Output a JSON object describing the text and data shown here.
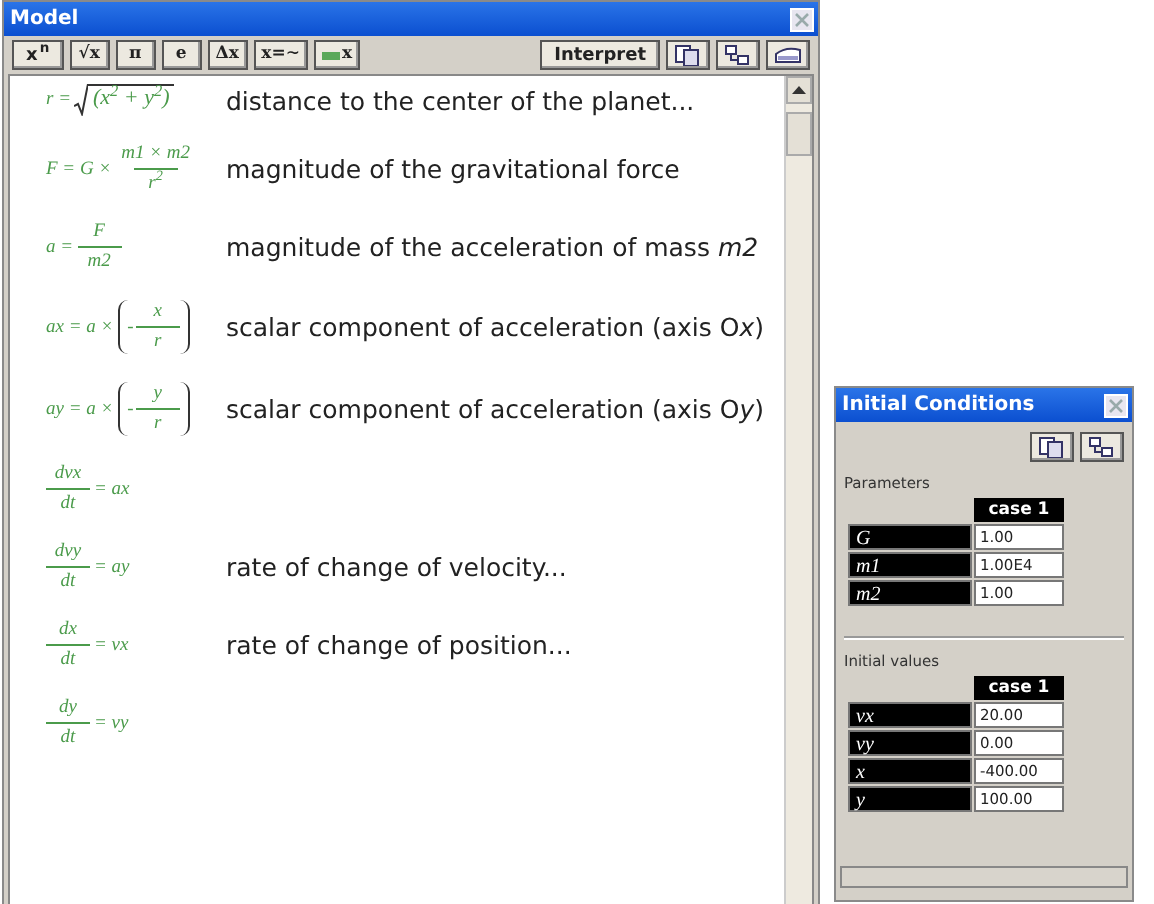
{
  "model": {
    "title": "Model",
    "toolbar": {
      "left": [
        {
          "kind": "text",
          "label": "x$^{n}$"
        },
        {
          "kind": "text",
          "label": "√x"
        },
        {
          "kind": "text",
          "label": "π"
        },
        {
          "kind": "text",
          "label": "e"
        },
        {
          "kind": "text",
          "label": "Δx"
        },
        {
          "kind": "text",
          "label": "x=∼"
        },
        {
          "kind": "prefixed",
          "label": "x"
        }
      ],
      "right": [
        {
          "kind": "text",
          "label": "Interpret"
        },
        {
          "kind": "copy"
        },
        {
          "kind": "connect"
        },
        {
          "kind": "device"
        }
      ]
    },
    "rows": [
      {
        "formula": [
          {
            "kind": "text",
            "s": "r ="
          },
          {
            "kind": "sqrt",
            "s": "(x$^{2}$ + y$^{2}$)"
          }
        ],
        "description": [
          {
            "s": "distance to the center of the planet..."
          }
        ]
      },
      {
        "formula": [
          {
            "kind": "text",
            "s": "F = G ×"
          },
          {
            "kind": "frac",
            "num": "m1 × m2",
            "den": "r$^{2}$"
          }
        ],
        "description": [
          {
            "s": "magnitude of the gravitational force"
          }
        ]
      },
      {
        "formula": [
          {
            "kind": "text",
            "s": "a ="
          },
          {
            "kind": "frac",
            "num": "F",
            "den": "m2"
          }
        ],
        "description": [
          {
            "s": "magnitude of the acceleration of mass "
          },
          {
            "s": "m2",
            "italic": true
          }
        ]
      },
      {
        "formula": [
          {
            "kind": "text",
            "s": "ax = a ×"
          },
          {
            "kind": "paren",
            "items": [
              {
                "kind": "text",
                "s": "-"
              },
              {
                "kind": "frac",
                "num": "x",
                "den": "r"
              }
            ]
          }
        ],
        "description": [
          {
            "s": "scalar component of acceleration (axis O"
          },
          {
            "s": "x",
            "italic": true
          },
          {
            "s": ")"
          }
        ]
      },
      {
        "formula": [
          {
            "kind": "text",
            "s": "ay = a ×"
          },
          {
            "kind": "paren",
            "items": [
              {
                "kind": "text",
                "s": "-"
              },
              {
                "kind": "frac",
                "num": "y",
                "den": "r"
              }
            ]
          }
        ],
        "description": [
          {
            "s": "scalar component of acceleration (axis O"
          },
          {
            "s": "y",
            "italic": true
          },
          {
            "s": ")"
          }
        ]
      },
      {
        "formula": [
          {
            "kind": "frac",
            "num": "dvx",
            "den": "dt"
          },
          {
            "kind": "text",
            "s": "= ax"
          }
        ]
      },
      {
        "formula": [
          {
            "kind": "frac",
            "num": "dvy",
            "den": "dt"
          },
          {
            "kind": "text",
            "s": "= ay"
          }
        ],
        "description": [
          {
            "s": "rate of change of velocity..."
          }
        ]
      },
      {
        "formula": [
          {
            "kind": "frac",
            "num": "dx",
            "den": "dt"
          },
          {
            "kind": "text",
            "s": "= vx"
          }
        ],
        "description": [
          {
            "s": "rate of change of position..."
          }
        ]
      },
      {
        "formula": [
          {
            "kind": "frac",
            "num": "dy",
            "den": "dt"
          },
          {
            "kind": "text",
            "s": "= vy"
          }
        ]
      }
    ]
  },
  "initial_conditions": {
    "title": "Initial Conditions",
    "tools": [
      {
        "kind": "copy"
      },
      {
        "kind": "connect"
      }
    ],
    "sections": [
      {
        "title": "Parameters",
        "column": "case 1",
        "rows": [
          {
            "name": "G",
            "value": "1.00"
          },
          {
            "name": "m1",
            "value": "1.00E4"
          },
          {
            "name": "m2",
            "value": "1.00"
          }
        ]
      },
      {
        "title": "Initial values",
        "column": "case 1",
        "rows": [
          {
            "name": "vx",
            "value": "20.00"
          },
          {
            "name": "vy",
            "value": "0.00"
          },
          {
            "name": "x",
            "value": "-400.00"
          },
          {
            "name": "y",
            "value": "100.00"
          }
        ]
      }
    ]
  }
}
